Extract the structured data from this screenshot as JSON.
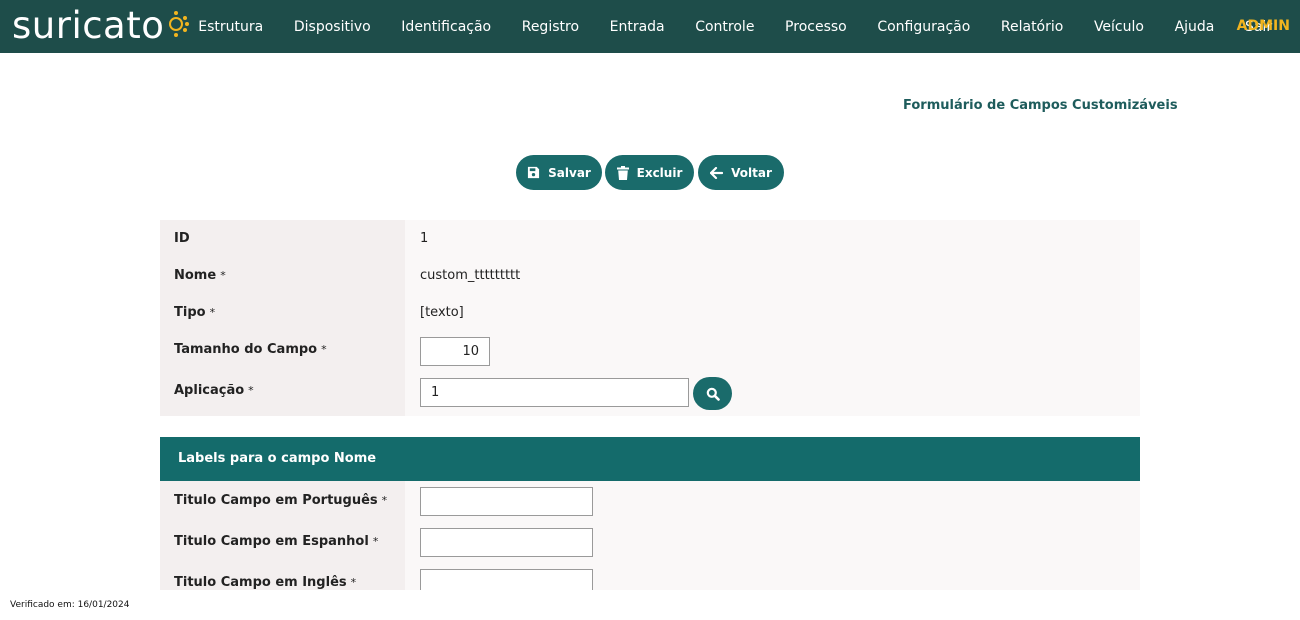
{
  "app": {
    "logo_text": "suricato",
    "accent_color": "#f2b51f",
    "brand_color": "#1e4d4a",
    "button_color": "#1a6b6b"
  },
  "nav": {
    "items": [
      "Estrutura",
      "Dispositivo",
      "Identificação",
      "Registro",
      "Entrada",
      "Controle",
      "Processo",
      "Configuração",
      "Relatório",
      "Veículo",
      "Ajuda",
      "Sair"
    ],
    "user": "ADMIN"
  },
  "page": {
    "title": "Formulário de Campos Customizáveis"
  },
  "toolbar": {
    "save_label": "Salvar",
    "save_icon": "floppy-disk-icon",
    "delete_label": "Excluir",
    "delete_icon": "trash-icon",
    "back_label": "Voltar",
    "back_icon": "arrow-left-icon"
  },
  "form": {
    "required_mark": "*",
    "fields": {
      "id": {
        "label": "ID",
        "value": "1"
      },
      "nome": {
        "label": "Nome",
        "value": "custom_ttttttttt"
      },
      "tipo": {
        "label": "Tipo",
        "value": "[texto]"
      },
      "tamanho": {
        "label": "Tamanho do Campo",
        "value": "10"
      },
      "aplicacao": {
        "label": "Aplicação",
        "value": "1",
        "search_icon": "search-icon"
      }
    }
  },
  "labels_section": {
    "title": "Labels para o campo Nome",
    "fields": [
      {
        "label": "Titulo Campo em Português",
        "value": ""
      },
      {
        "label": "Titulo Campo em Espanhol",
        "value": ""
      },
      {
        "label": "Titulo Campo em Inglês",
        "value": ""
      }
    ]
  },
  "footer": {
    "verified_text": "Verificado em: 16/01/2024"
  }
}
